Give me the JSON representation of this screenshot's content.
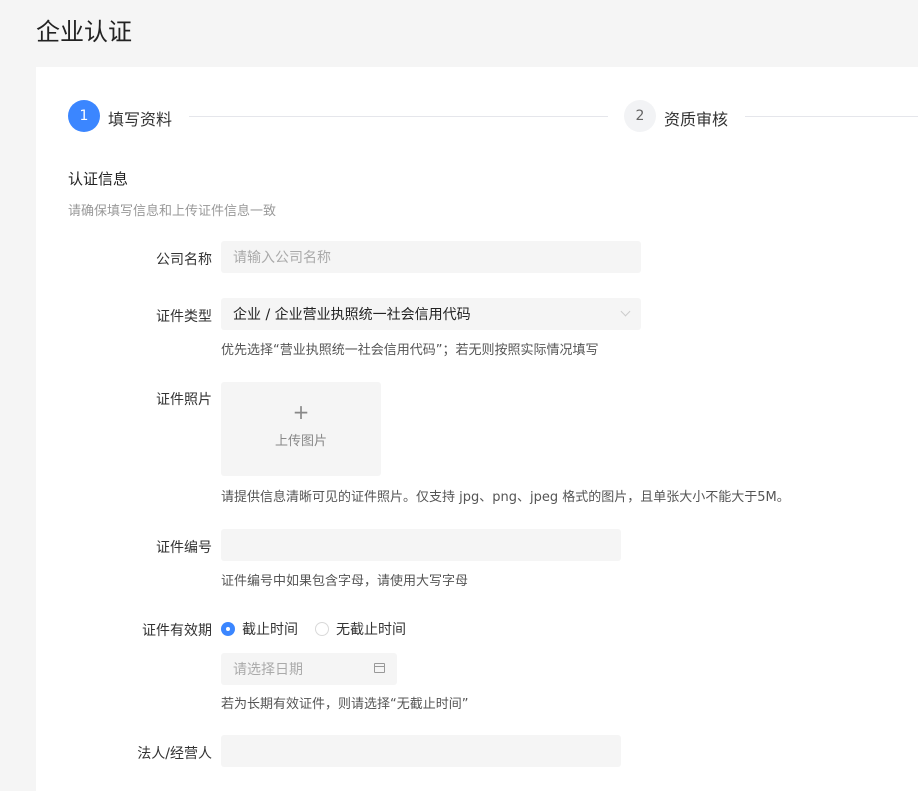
{
  "page": {
    "title": "企业认证"
  },
  "steps": [
    {
      "number": "1",
      "label": "填写资料",
      "state": "active"
    },
    {
      "number": "2",
      "label": "资质审核",
      "state": "inactive"
    }
  ],
  "section": {
    "title": "认证信息",
    "subtitle": "请确保填写信息和上传证件信息一致"
  },
  "form": {
    "company_name": {
      "label": "公司名称",
      "placeholder": "请输入公司名称",
      "value": ""
    },
    "cert_type": {
      "label": "证件类型",
      "value": "企业 / 企业营业执照统一社会信用代码",
      "hint": "优先选择“营业执照统一社会信用代码”；若无则按照实际情况填写"
    },
    "cert_photo": {
      "label": "证件照片",
      "upload_icon": "plus-icon",
      "upload_text": "上传图片",
      "hint": "请提供信息清晰可见的证件照片。仅支持 jpg、png、jpeg 格式的图片，且单张大小不能大于5M。"
    },
    "cert_number": {
      "label": "证件编号",
      "value": "",
      "hint": "证件编号中如果包含字母，请使用大写字母"
    },
    "validity": {
      "label": "证件有效期",
      "options": [
        {
          "label": "截止时间",
          "checked": true
        },
        {
          "label": "无截止时间",
          "checked": false
        }
      ],
      "date_placeholder": "请选择日期",
      "hint": "若为长期有效证件，则请选择“无截止时间”"
    },
    "legal_person": {
      "label": "法人/经营人",
      "value": ""
    }
  },
  "colors": {
    "accent": "#3b86ff",
    "background": "#f5f5f5",
    "input_bg": "#f5f5f5"
  }
}
